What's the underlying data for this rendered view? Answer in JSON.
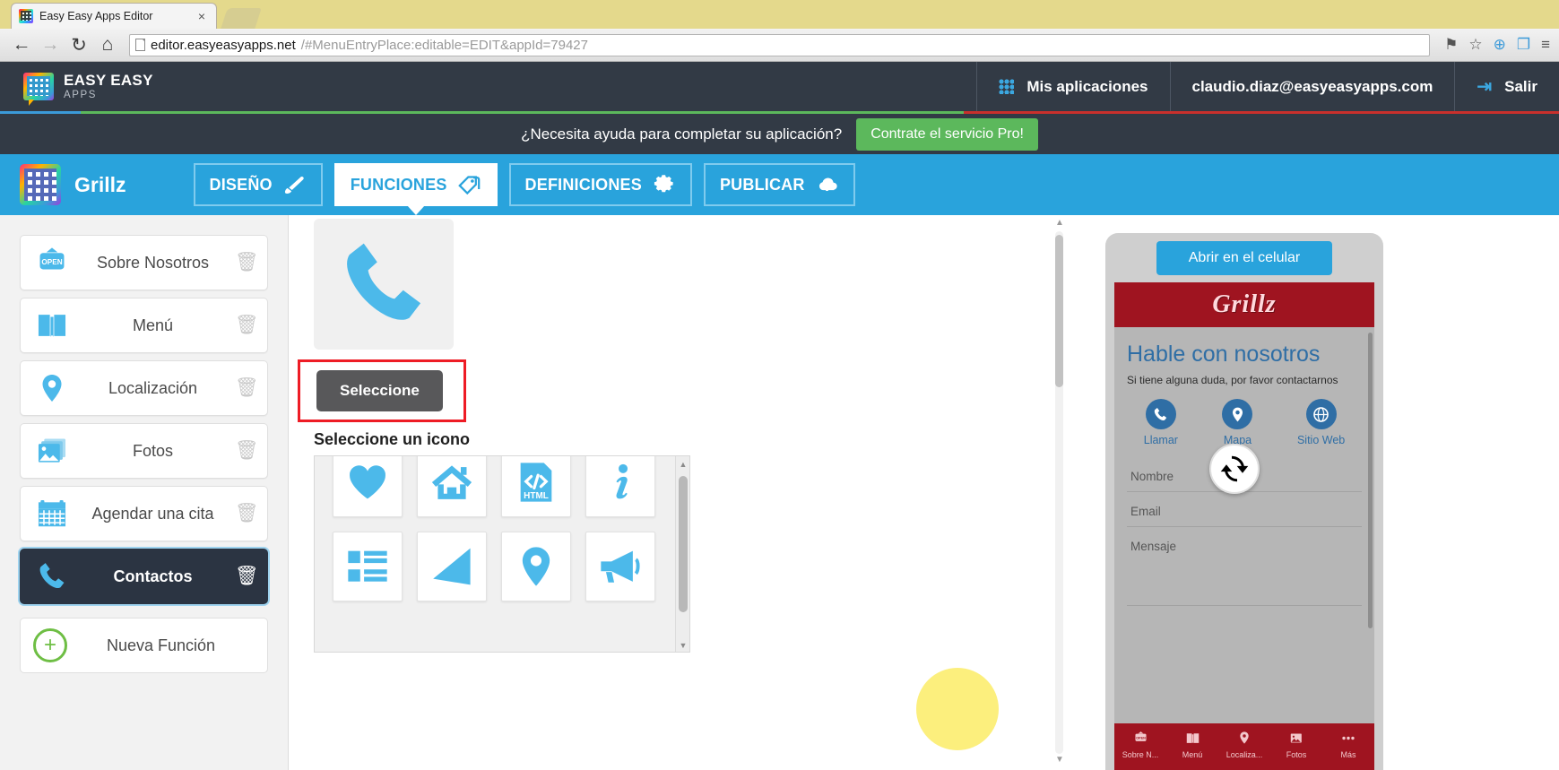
{
  "browser": {
    "tab_title": "Easy Easy Apps Editor",
    "tab_close": "×",
    "back_arrow": "←",
    "forward_arrow": "→",
    "reload": "↻",
    "home": "⌂",
    "url_host": "editor.easyeasyapps.net",
    "url_rest": "/#MenuEntryPlace:editable=EDIT&appId=79427",
    "icon_pin": "⚑",
    "icon_star": "☆",
    "icon_ext": "⊕",
    "icon_cast": "❐",
    "icon_menu": "≡"
  },
  "header": {
    "brand_main": "EASY EASY",
    "brand_sub": "APPS",
    "my_apps": "Mis aplicaciones",
    "account_email": "claudio.diaz@easyeasyapps.com",
    "logout": "Salir",
    "logout_icon": "⇥"
  },
  "promo": {
    "text": "¿Necesita ayuda para completar su aplicación?",
    "button": "Contrate el servicio Pro!"
  },
  "toolbar": {
    "app_name": "Grillz",
    "tabs": [
      {
        "label": "DISEÑO",
        "icon": "brush-icon",
        "active": false
      },
      {
        "label": "FUNCIONES",
        "icon": "tags-icon",
        "active": true
      },
      {
        "label": "DEFINICIONES",
        "icon": "gear-icon",
        "active": false
      },
      {
        "label": "PUBLICAR",
        "icon": "cloud-upload-icon",
        "active": false
      }
    ]
  },
  "functions_list": {
    "items": [
      {
        "label": "Sobre Nosotros",
        "icon": "open-sign-icon",
        "selected": false
      },
      {
        "label": "Menú",
        "icon": "book-icon",
        "selected": false
      },
      {
        "label": "Localización",
        "icon": "map-pin-icon",
        "selected": false
      },
      {
        "label": "Fotos",
        "icon": "photos-icon",
        "selected": false
      },
      {
        "label": "Agendar una cita",
        "icon": "calendar-icon",
        "selected": false
      },
      {
        "label": "Contactos",
        "icon": "phone-icon",
        "selected": true
      }
    ],
    "trash_glyph": "🗑",
    "new_function": "Nueva Función",
    "new_function_icon": "plus-circle-icon"
  },
  "editor": {
    "current_icon": "phone-icon",
    "select_button": "Seleccione",
    "pick_icon_title": "Seleccione un icono",
    "icon_options": [
      "heart-icon",
      "home-icon",
      "html-code-icon",
      "info-icon",
      "list-icon",
      "send-icon",
      "map-pin-icon",
      "megaphone-icon"
    ],
    "scroll_up_arrow": "▲",
    "scroll_down_arrow": "▼"
  },
  "preview": {
    "open_mobile_button": "Abrir en el celular",
    "app_logo_text": "Grillz",
    "heading": "Hable con nosotros",
    "subheading": "Si tiene alguna duda, por favor contactarnos",
    "actions": [
      {
        "label": "Llamar",
        "icon": "phone-icon"
      },
      {
        "label": "Mapa",
        "icon": "map-pin-icon"
      },
      {
        "label": "Sitio Web",
        "icon": "globe-icon"
      }
    ],
    "form": {
      "name_placeholder": "Nombre",
      "email_placeholder": "Email",
      "message_placeholder": "Mensaje"
    },
    "refresh_icon": "refresh-icon",
    "bottom_nav": [
      {
        "label": "Sobre N...",
        "icon": "open-sign-icon"
      },
      {
        "label": "Menú",
        "icon": "book-icon"
      },
      {
        "label": "Localiza...",
        "icon": "map-pin-icon"
      },
      {
        "label": "Fotos",
        "icon": "photos-icon"
      },
      {
        "label": "Más",
        "icon": "ellipsis-icon"
      }
    ]
  },
  "colors": {
    "accent_blue": "#29a3dc",
    "header_dark": "#323a45",
    "promo_green": "#5cb85c",
    "highlight_red": "#ee1c25",
    "phone_red": "#9f1420",
    "selected_item": "#2b3442"
  }
}
